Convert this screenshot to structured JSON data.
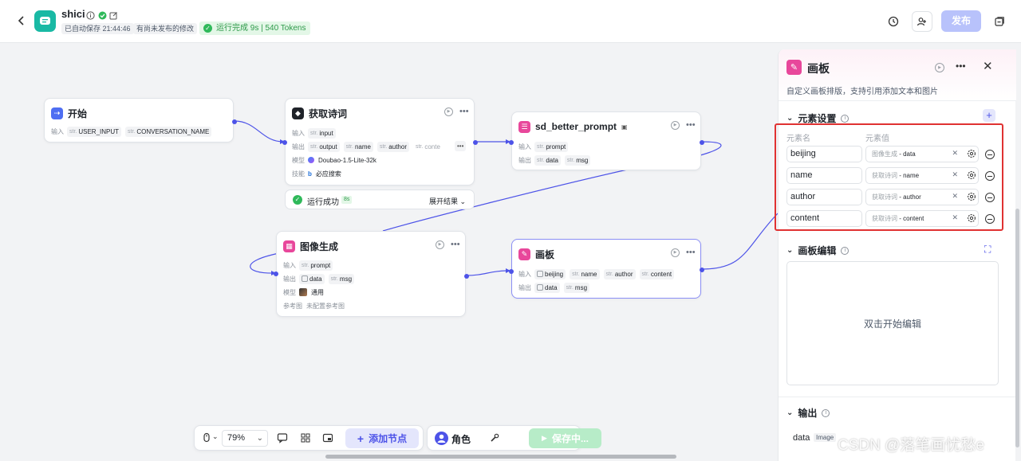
{
  "app": {
    "name": "shici",
    "autosave": "已自动保存 21:44:46",
    "unpublished": "有尚未发布的修改",
    "run_status": "运行完成 9s | 540 Tokens",
    "publish_label": "发布"
  },
  "nodes": {
    "start": {
      "title": "开始",
      "input_label": "输入",
      "inputs": [
        "USER_INPUT",
        "CONVERSATION_NAME"
      ]
    },
    "fetch": {
      "title": "获取诗词",
      "input_label": "输入",
      "output_label": "输出",
      "model_label": "模型",
      "skill_label": "技能",
      "inputs": [
        "input"
      ],
      "outputs": [
        "output",
        "name",
        "author",
        "conte"
      ],
      "model": "Doubao-1.5-Lite-32k",
      "skill": "必应搜索",
      "run_status": "运行成功",
      "run_time": "8s",
      "expand": "展开结果"
    },
    "sd": {
      "title": "sd_better_prompt",
      "input_label": "输入",
      "output_label": "输出",
      "inputs": [
        "prompt"
      ],
      "outputs": [
        "data",
        "msg"
      ]
    },
    "image": {
      "title": "图像生成",
      "input_label": "输入",
      "output_label": "输出",
      "model_label": "模型",
      "ref_label": "参考图",
      "inputs": [
        "prompt"
      ],
      "outputs": [
        "data",
        "msg"
      ],
      "model": "通用",
      "ref": "未配置参考图"
    },
    "board": {
      "title": "画板",
      "input_label": "输入",
      "output_label": "输出",
      "inputs": [
        "beijing",
        "name",
        "author",
        "content"
      ],
      "outputs": [
        "data",
        "msg"
      ]
    }
  },
  "type_tag": "str.",
  "panel": {
    "title": "画板",
    "desc": "自定义画板排版，支持引用添加文本和图片",
    "elements_title": "元素设置",
    "col_name": "元素名",
    "col_value": "元素值",
    "elements": [
      {
        "name": "beijing",
        "src": "图像生成",
        "field": "data"
      },
      {
        "name": "name",
        "src": "获取诗词",
        "field": "name"
      },
      {
        "name": "author",
        "src": "获取诗词",
        "field": "author"
      },
      {
        "name": "content",
        "src": "获取诗词",
        "field": "content"
      }
    ],
    "editor_title": "画板编辑",
    "editor_hint": "双击开始编辑",
    "output_title": "输出",
    "output_name": "data",
    "output_type": "Image"
  },
  "toolbar": {
    "zoom": "79%",
    "add_node": "添加节点",
    "role": "角色",
    "saving": "保存中..."
  },
  "watermark": "CSDN @落笔画忧愁e",
  "colors": {
    "accent": "#4d53e8",
    "success": "#2fb95a",
    "highlight": "#e03232",
    "board_icon": "#e8479b"
  }
}
